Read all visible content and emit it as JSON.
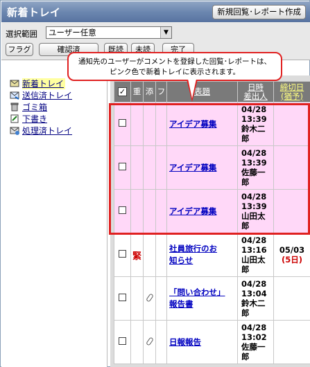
{
  "window": {
    "title": "新着トレイ",
    "new_button": "新規回覧･レポート作成"
  },
  "toolbar": {
    "scope_label": "選択範囲",
    "scope_value": "ユーザー任意",
    "buttons": [
      "フラグ",
      "確認済",
      "既読",
      "未読",
      "完了"
    ]
  },
  "folders": [
    {
      "label": "新着トレイ",
      "icon": "inbox-tray-icon",
      "selected": true
    },
    {
      "label": "送信済トレイ",
      "icon": "sent-tray-icon"
    },
    {
      "label": "ゴミ箱",
      "icon": "trash-icon"
    },
    {
      "label": "下書き",
      "icon": "draft-icon"
    },
    {
      "label": "処理済トレイ",
      "icon": "processed-tray-icon"
    }
  ],
  "table": {
    "headers": {
      "check": "✓",
      "important": "重",
      "attach": "添",
      "flag": "フ",
      "subject": "表題",
      "datetime_line1": "日時",
      "datetime_line2": "差出人",
      "deadline_line1": "締切日",
      "deadline_line2": "(猶予)"
    },
    "rows": [
      {
        "subject": "アイデア募集",
        "date": "04/28",
        "time": "13:39",
        "sender": "鈴木二郎",
        "sender1": "鈴木二",
        "sender2": "郎",
        "pink": true
      },
      {
        "subject": "アイデア募集",
        "date": "04/28",
        "time": "13:39",
        "sender": "佐藤一郎",
        "sender1": "佐藤一",
        "sender2": "郎",
        "pink": true
      },
      {
        "subject": "アイデア募集",
        "date": "04/28",
        "time": "13:39",
        "sender": "山田太郎",
        "sender1": "山田太",
        "sender2": "郎",
        "pink": true
      },
      {
        "subject": "社員旅行のお知らせ",
        "subject1": "社員旅行のお",
        "subject2": "知らせ",
        "date": "04/28",
        "time": "13:16",
        "sender": "山田太郎",
        "sender1": "山田太",
        "sender2": "郎",
        "important": "緊",
        "deadline": "05/03",
        "grace": "(5日)"
      },
      {
        "subject": "「問い合わせ」報告書",
        "subject1": "「問い合わせ」",
        "subject2": "報告書",
        "date": "04/28",
        "time": "13:04",
        "sender": "鈴木二郎",
        "sender1": "鈴木二",
        "sender2": "郎",
        "attachment": true
      },
      {
        "subject": "日報報告",
        "date": "04/28",
        "time": "13:02",
        "sender": "佐藤一郎",
        "sender1": "佐藤一",
        "sender2": "郎",
        "attachment": true
      }
    ]
  },
  "callout": {
    "line1": "通知先のユーザーがコメントを登録した回覧･レポートは、",
    "line2": "ピンク色で新着トレイに表示されます。"
  },
  "colors": {
    "pink_row": "#ffd8f8",
    "highlight": "#e02020",
    "titlebar": "#6c87b0",
    "link": "#0000c0"
  }
}
